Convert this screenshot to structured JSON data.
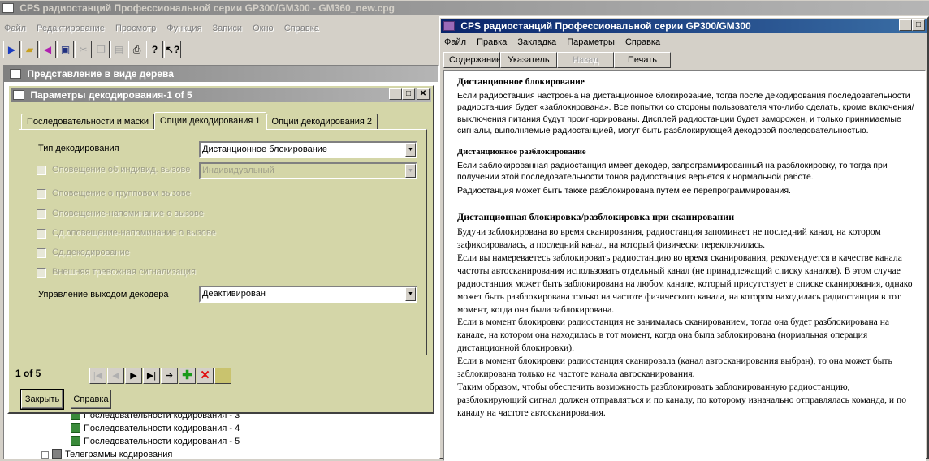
{
  "main_window": {
    "title": "CPS радиостанций Профессиональной серии GP300/GM300 - GM360_new.cpg",
    "menu": [
      "Файл",
      "Редактирование",
      "Просмотр",
      "Функция",
      "Записи",
      "Окно",
      "Справка"
    ]
  },
  "toolbar_icons": [
    "new-icon",
    "open-icon",
    "read-radio-icon",
    "save-icon",
    "cut-icon",
    "copy-icon",
    "paste-icon",
    "print-icon",
    "help-icon",
    "context-help-icon"
  ],
  "tree": {
    "title": "Представление в виде дерева",
    "items": [
      {
        "label": "Последовательности кодирования - 3"
      },
      {
        "label": "Последовательности кодирования - 4"
      },
      {
        "label": "Последовательности кодирования - 5"
      },
      {
        "label": "Телеграммы кодирования"
      }
    ]
  },
  "dialog": {
    "title": "Параметры декодирования-1 of 5",
    "tabs": [
      "Последовательности и маски",
      "Опции декодирования 1",
      "Опции декодирования 2"
    ],
    "active_tab": 1,
    "decode_type_label": "Тип декодирования",
    "decode_type_value": "Дистанционное блокирование",
    "disabled_checkboxes": [
      "Оповещение об индивид. вызове",
      "Оповещение о групповом вызове",
      "Оповещение-напоминание о вызове",
      "Сд.оповещение-напоминание о вызове",
      "Сд.декодирование",
      "Внешняя тревожная сигнализация"
    ],
    "call_type_value": "Индивидуальный",
    "decoder_output_label": "Управление выходом декодера",
    "decoder_output_value": "Деактивирован",
    "record_counter": "1 of 5",
    "close_button": "Закрыть",
    "help_button": "Справка"
  },
  "help_window": {
    "title": "CPS радиостанций Профессиональной серии GP300/GM300",
    "menu": [
      "Файл",
      "Правка",
      "Закладка",
      "Параметры",
      "Справка"
    ],
    "buttons": [
      "Содержание",
      "Указатель",
      "Назад",
      "Печать"
    ],
    "sections": {
      "remote_block_title": "Дистанционное блокирование",
      "remote_block_text": "Если радиостанция настроена на дистанционное блокирование, тогда после декодирования последовательности радиостанция будет «заблокирована». Все попытки со стороны пользователя что-либо сделать, кроме включения/выключения питания будут проигнорированы. Дисплей радиостанции будет заморожен, и только принимаемые сигналы, выполняемые радиостанцией, могут быть разблокирующей декодовой последовательностью.",
      "remote_unblock_title": "Дистанционное разблокирование",
      "remote_unblock_text": "Если заблокированная радиостанция имеет декодер, запрограммированный на разблокировку, то тогда при получении этой последовательности тонов радиостанция вернется к нормальной работе.",
      "remote_unblock_text2": "Радиостанция может быть также разблокирована путем ее перепрограммирования.",
      "scan_title": "Дистанционная блокировка/разблокировка при сканировании",
      "scan_p1": "Будучи заблокирована во время сканирования, радиостанция запоминает не последний канал, на котором зафиксировалась, а последний канал, на который физически переключилась.",
      "scan_p2": "Если вы намереваетесь заблокировать радиостанцию во время сканирования, рекомендуется в качестве канала частоты автосканирования использовать отдельный канал (не принадлежащий списку каналов). В этом случае радиостанция может быть заблокирована на любом канале, который присутствует в списке сканирования, однако может быть разблокирована только на частоте физического канала, на котором находилась радиостанция в тот момент, когда она была заблокирована.",
      "scan_p3": "Если в момент блокировки радиостанция не занималась сканированием, тогда она будет разблокирована на канале, на котором она находилась в тот момент, когда она была заблокирована (нормальная операция дистанционной блокировки).",
      "scan_p4": "Если в момент блокировки радиостанция сканировала (канал автосканирования выбран), то она может быть заблокирована только на частоте канала автосканирования.",
      "scan_p5": "Таким образом, чтобы обеспечить возможность разблокировать заблокированную радиостанцию, разблокирующий сигнал должен отправляться и по каналу, по которому изначально отправлялась команда, и по каналу на частоте автосканирования."
    }
  }
}
